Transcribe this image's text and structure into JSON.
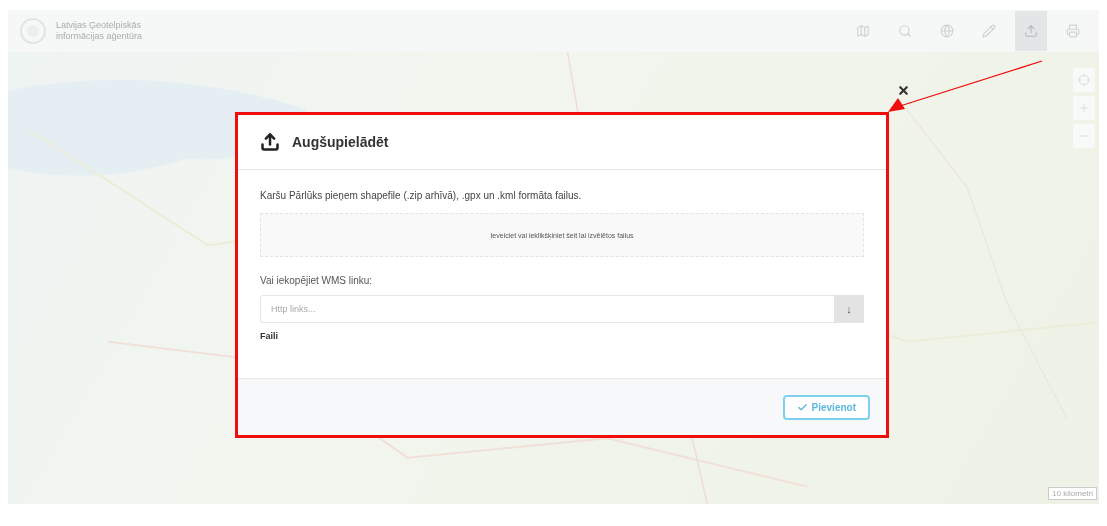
{
  "header": {
    "agency_name": [
      "Latvijas Ģeotelpiskās",
      "informācijas aģentūra"
    ],
    "toolbar": [
      {
        "kind": "map",
        "selected": false
      },
      {
        "kind": "search",
        "selected": false
      },
      {
        "kind": "globe",
        "selected": false
      },
      {
        "kind": "pencil",
        "selected": false
      },
      {
        "kind": "upload",
        "selected": true
      },
      {
        "kind": "print",
        "selected": false
      }
    ]
  },
  "map": {
    "scale": "10 kilometri"
  },
  "dialog": {
    "title": "Augšupielādēt",
    "intro": "Karšu Pārlūks pieņem shapefile (.zip arhīvā), .gpx un .kml formāta failus.",
    "dropzone": "Ievelciet vai ieklikšķiniet šeit lai izvēlētos failus",
    "wms_label": "Vai iekopējiet WMS linku:",
    "wms_field": {
      "placeholder": "Http links...",
      "button": "↓"
    },
    "files_heading": "Faili",
    "submit": "Pievienot"
  }
}
